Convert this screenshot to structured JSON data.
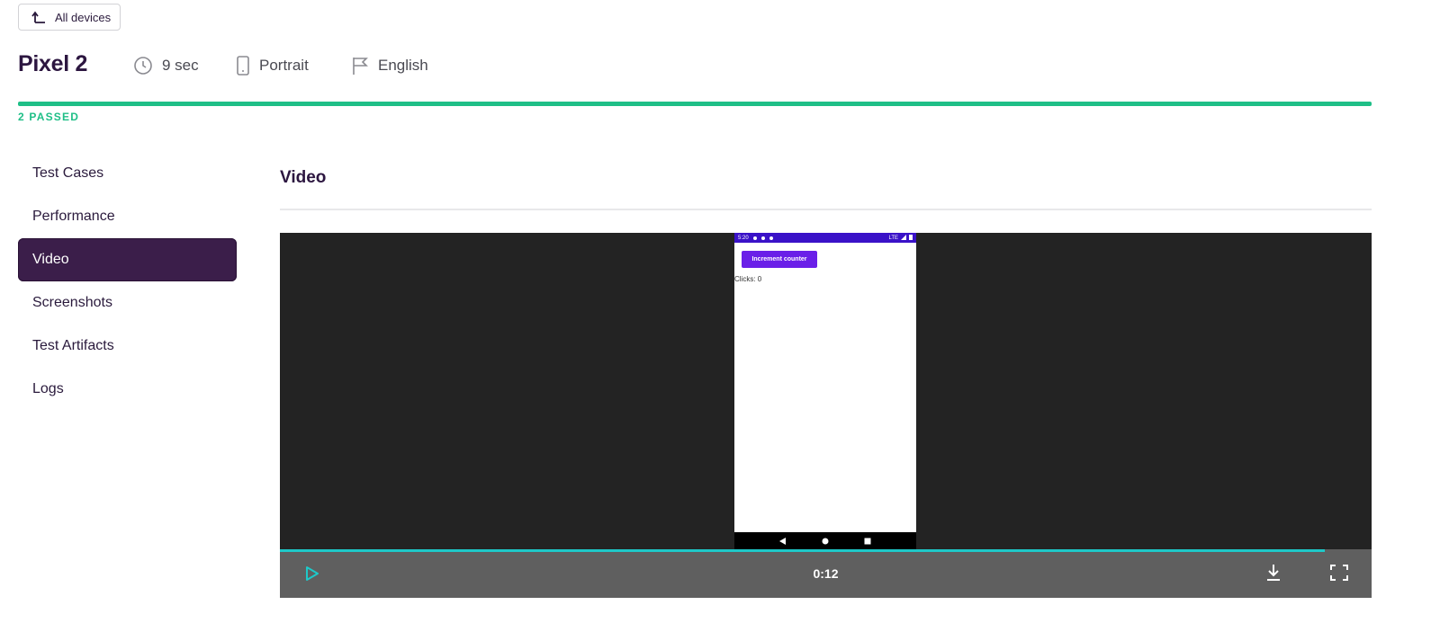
{
  "back_button": {
    "label": "All devices",
    "icon": "arrow-up-left-icon"
  },
  "device": {
    "name": "Pixel 2",
    "duration": "9 sec",
    "orientation": "Portrait",
    "locale": "English"
  },
  "results": {
    "passed_label": "2 PASSED",
    "passed_fraction": 1.0,
    "color": "#1fbf87"
  },
  "sidebar": {
    "items": [
      {
        "label": "Test Cases",
        "active": false
      },
      {
        "label": "Performance",
        "active": false
      },
      {
        "label": "Video",
        "active": true
      },
      {
        "label": "Screenshots",
        "active": false
      },
      {
        "label": "Test Artifacts",
        "active": false
      },
      {
        "label": "Logs",
        "active": false
      }
    ]
  },
  "section": {
    "title": "Video"
  },
  "video": {
    "phone": {
      "status_time": "5:20",
      "status_network": "LTE",
      "app_button": "Increment counter",
      "clicks_text": "Clicks: 0"
    },
    "timecode": "0:12",
    "progress_fraction": 0.957
  },
  "colors": {
    "accent": "#3b1e4a",
    "success": "#1fbf87",
    "seek": "#1ec8c8"
  }
}
